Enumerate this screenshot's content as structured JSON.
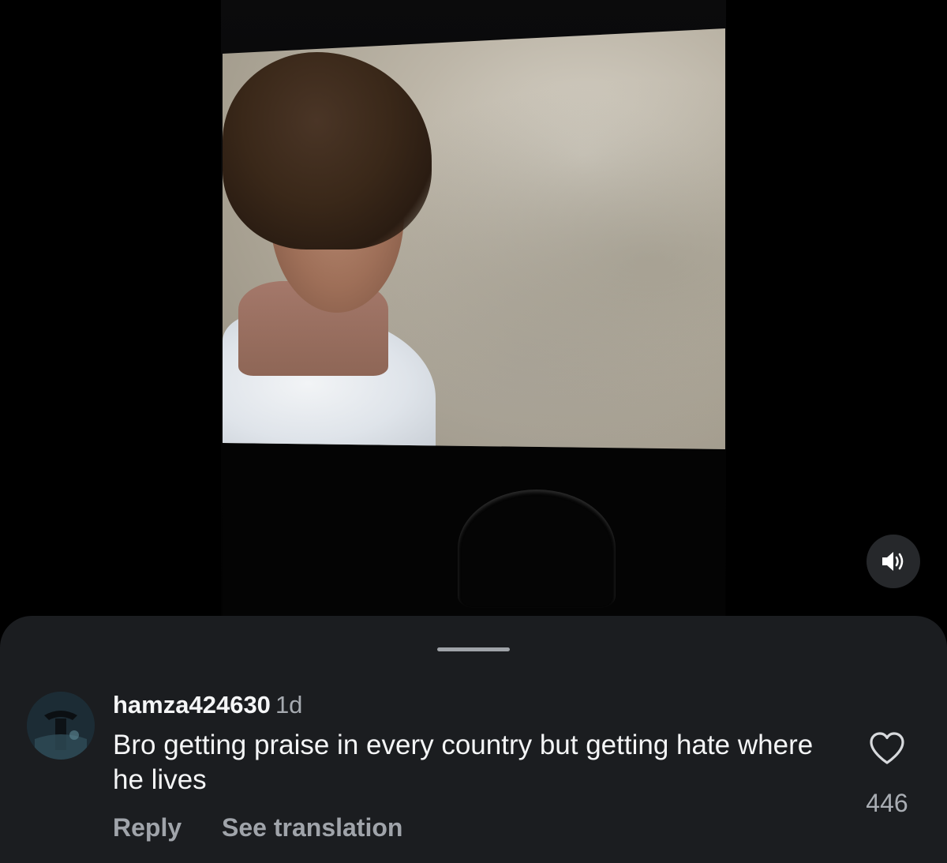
{
  "video": {
    "sound_icon": "speaker-on-icon"
  },
  "comment": {
    "username": "hamza424630",
    "time": "1d",
    "text": "Bro getting praise in every country but getting hate where he lives",
    "reply_label": "Reply",
    "translation_label": "See translation",
    "like_icon": "heart-outline-icon",
    "like_count": "446"
  },
  "colors": {
    "sheet_bg": "#1b1d20",
    "secondary_text": "#a0a4aa",
    "primary_text": "#f4f5f6"
  }
}
